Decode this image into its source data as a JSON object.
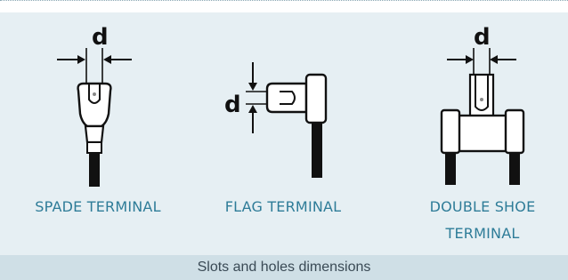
{
  "terminals": [
    {
      "label": "SPADE TERMINAL",
      "dimension": "d"
    },
    {
      "label": "FLAG TERMINAL",
      "dimension": "d"
    },
    {
      "label_line1": "DOUBLE SHOE",
      "label_line2": "TERMINAL",
      "dimension": "d"
    }
  ],
  "caption": "Slots and holes dimensions",
  "colors": {
    "panel": "#e6eff3",
    "caption_bar": "#cfdfe6",
    "label_text": "#2e7c98",
    "caption_text": "#3a4a55"
  }
}
